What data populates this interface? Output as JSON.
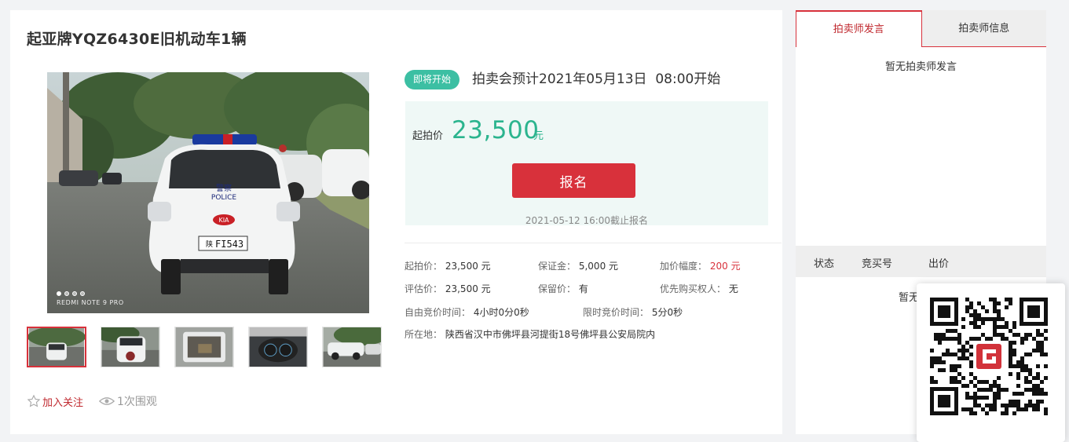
{
  "lot": {
    "title": "起亚牌YQZ6430E旧机动车1辆"
  },
  "gallery": {
    "watermark": "REDMI NOTE 9 PRO",
    "plate_text": "FI543",
    "plate_prefix": "陕",
    "car_text_police": "POLICE",
    "car_text_jingcha": "警察",
    "car_brand": "KIA",
    "thumbnails": [
      "car-front",
      "car-rear",
      "car-trunk",
      "car-dashboard",
      "car-side"
    ]
  },
  "actions": {
    "follow_label": "加入关注",
    "views_label": "1次围观"
  },
  "status": {
    "badge": "即将开始",
    "text": "拍卖会预计2021年05月13日  08:00开始"
  },
  "price": {
    "label": "起拍价",
    "value": "23,500",
    "unit": "元",
    "signup_label": "报名",
    "deadline": "2021-05-12 16:00截止报名"
  },
  "info": {
    "start_price_label": "起拍价：",
    "start_price_value": "23,500 元",
    "deposit_label": "保证金：",
    "deposit_value": "5,000 元",
    "increment_label": "加价幅度：",
    "increment_value": "200 元",
    "appraisal_label": "评估价：",
    "appraisal_value": "23,500 元",
    "reserve_label": "保留价：",
    "reserve_value": "有",
    "priority_label": "优先购买权人：",
    "priority_value": "无",
    "free_time_label": "自由竞价时间：",
    "free_time_value": "4小时0分0秒",
    "limit_time_label": "限时竞价时间：",
    "limit_time_value": "5分0秒",
    "location_label": "所在地：",
    "location_value": "陕西省汉中市佛坪县河提街18号佛坪县公安局院内"
  },
  "side": {
    "tabs": [
      "拍卖师发言",
      "拍卖师信息"
    ],
    "empty_speech": "暂无拍卖师发言",
    "bid_columns": [
      "状态",
      "竞买号",
      "出价"
    ],
    "bid_empty": "暂无"
  },
  "colors": {
    "accent_red": "#d8313b",
    "accent_green": "#2bb48e",
    "badge_green": "#3cbfa3"
  }
}
